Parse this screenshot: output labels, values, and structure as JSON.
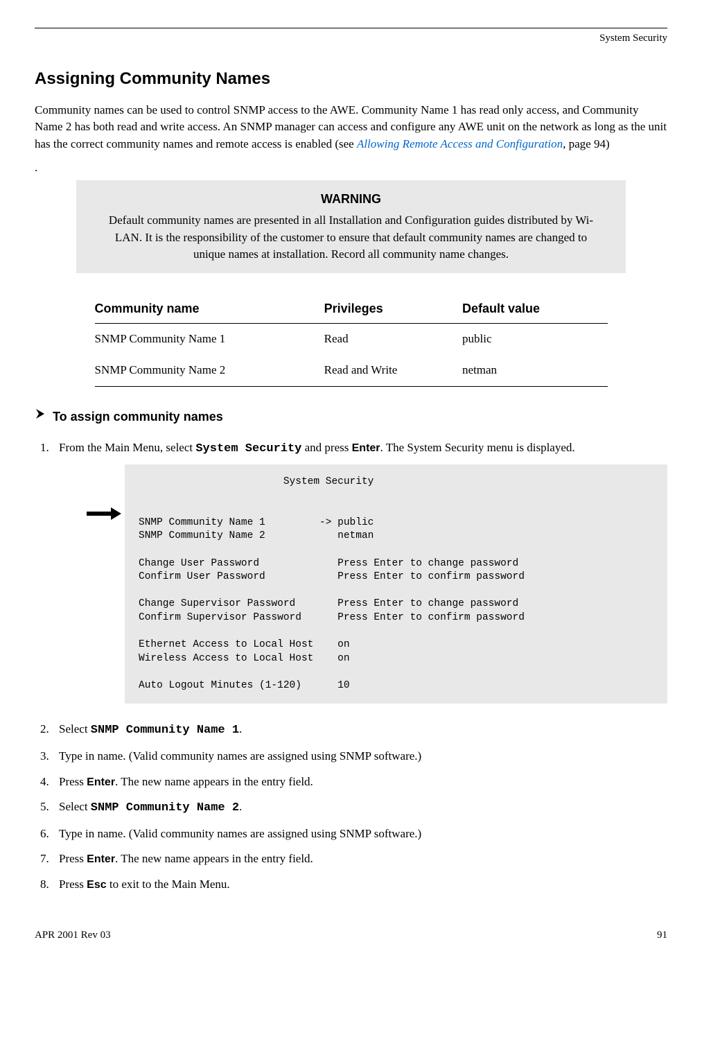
{
  "header": {
    "section": "System Security"
  },
  "title": "Assigning Community Names",
  "intro": {
    "text_before_link": "Community names can be used to control SNMP access to the AWE. Community Name 1 has read only access, and Community Name 2 has both read and write access. An SNMP manager can access and configure any AWE unit on the network as long as the unit has the correct community names and remote access is enabled (see ",
    "link_text": "Allowing Remote Access and Configuration",
    "text_after_link": ", page 94)"
  },
  "period": ".",
  "warning": {
    "title": "WARNING",
    "body": "Default community names are presented in all Installation and Configuration guides distributed by Wi-LAN. It is the responsibility of the customer to ensure that default community names are changed to unique names at installation. Record all community name changes."
  },
  "table": {
    "headers": [
      "Community name",
      "Privileges",
      "Default value"
    ],
    "rows": [
      [
        "SNMP Community Name 1",
        "Read",
        "public"
      ],
      [
        "SNMP Community Name 2",
        "Read and Write",
        "netman"
      ]
    ]
  },
  "subheading": "To assign community names",
  "step1": {
    "prefix": "From the Main Menu, select ",
    "mono": "System Security",
    "mid": " and press ",
    "bold": "Enter",
    "suffix": ". The System Security menu is displayed."
  },
  "terminal": "                        System Security\n\n\nSNMP Community Name 1         -> public\nSNMP Community Name 2            netman\n\nChange User Password             Press Enter to change password\nConfirm User Password            Press Enter to confirm password\n\nChange Supervisor Password       Press Enter to change password\nConfirm Supervisor Password      Press Enter to confirm password\n\nEthernet Access to Local Host    on\nWireless Access to Local Host    on\n\nAuto Logout Minutes (1-120)      10",
  "step2": {
    "prefix": "Select ",
    "mono": "SNMP Community Name 1",
    "suffix": "."
  },
  "step3": "Type in name. (Valid community names are assigned using SNMP software.)",
  "step4": {
    "prefix": "Press ",
    "bold": "Enter",
    "suffix": ". The new name appears in the entry field."
  },
  "step5": {
    "prefix": "Select ",
    "mono": "SNMP Community Name 2",
    "suffix": "."
  },
  "step6": "Type in name. (Valid community names are assigned using SNMP software.)",
  "step7": {
    "prefix": "Press ",
    "bold": "Enter",
    "suffix": ". The new name appears in the entry field."
  },
  "step8": {
    "prefix": "Press ",
    "bold": "Esc",
    "suffix": " to exit to the Main Menu."
  },
  "footer": {
    "left": "APR 2001 Rev 03",
    "right": "91"
  }
}
